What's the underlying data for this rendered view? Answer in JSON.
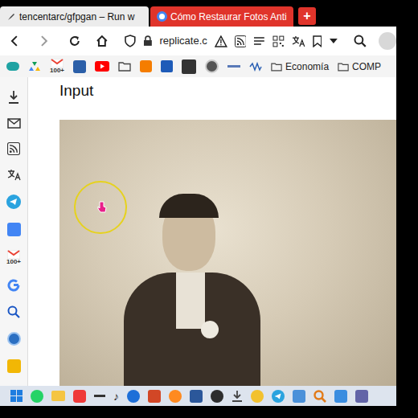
{
  "tabs": [
    {
      "label": "tencentarc/gfpgan – Run w",
      "selected": true
    },
    {
      "label": "Cómo Restaurar Fotos Anti",
      "selected": false
    }
  ],
  "new_tab": "+",
  "address": {
    "text": "replicate.c"
  },
  "bookmarks_bar": {
    "gmail_badge": "100+",
    "folders": [
      {
        "label": "Economía"
      },
      {
        "label": "COMP"
      }
    ]
  },
  "sidebar": {
    "gmail_badge": "100+"
  },
  "content": {
    "heading": "Input"
  }
}
